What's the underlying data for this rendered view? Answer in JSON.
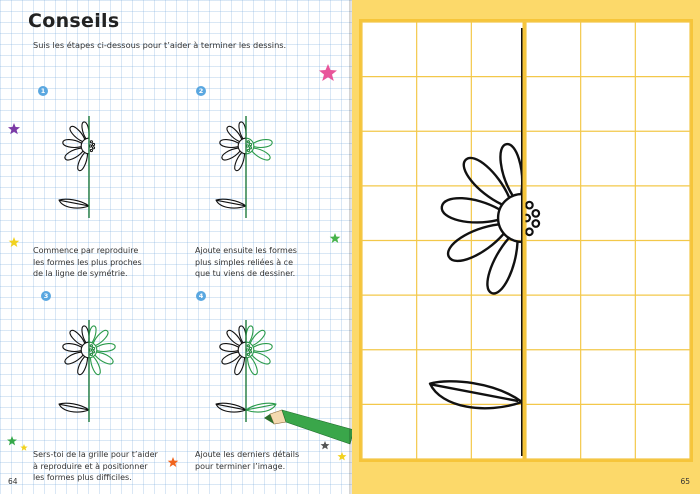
{
  "left_page": {
    "title": "Conseils",
    "intro": "Suis les étapes ci-dessous pour t’aider à terminer les dessins.",
    "steps": [
      {
        "number": "1",
        "caption_lines": [
          "Commence par reproduire",
          "les formes les plus proches",
          "de la ligne de symétrie."
        ]
      },
      {
        "number": "2",
        "caption_lines": [
          "Ajoute ensuite les formes",
          "plus simples reliées à ce",
          "que tu viens de dessiner."
        ]
      },
      {
        "number": "3",
        "caption_lines": [
          "Sers-toi de la grille pour t’aider",
          "à reproduire et à positionner",
          "les formes plus difficiles."
        ]
      },
      {
        "number": "4",
        "caption_lines": [
          "Ajoute les derniers détails",
          "pour terminer l’image."
        ]
      }
    ],
    "page_number": "64"
  },
  "right_page": {
    "page_number": "65"
  },
  "colors": {
    "outline": "#111111",
    "symmetry_line": "#1e7a3c",
    "mirror_lines": "#2a9a4a",
    "step_badge": "#5aa7e0",
    "right_background": "#fcd96a",
    "grid_lines": "#f3c84a",
    "pencil": "#3aa64a"
  }
}
